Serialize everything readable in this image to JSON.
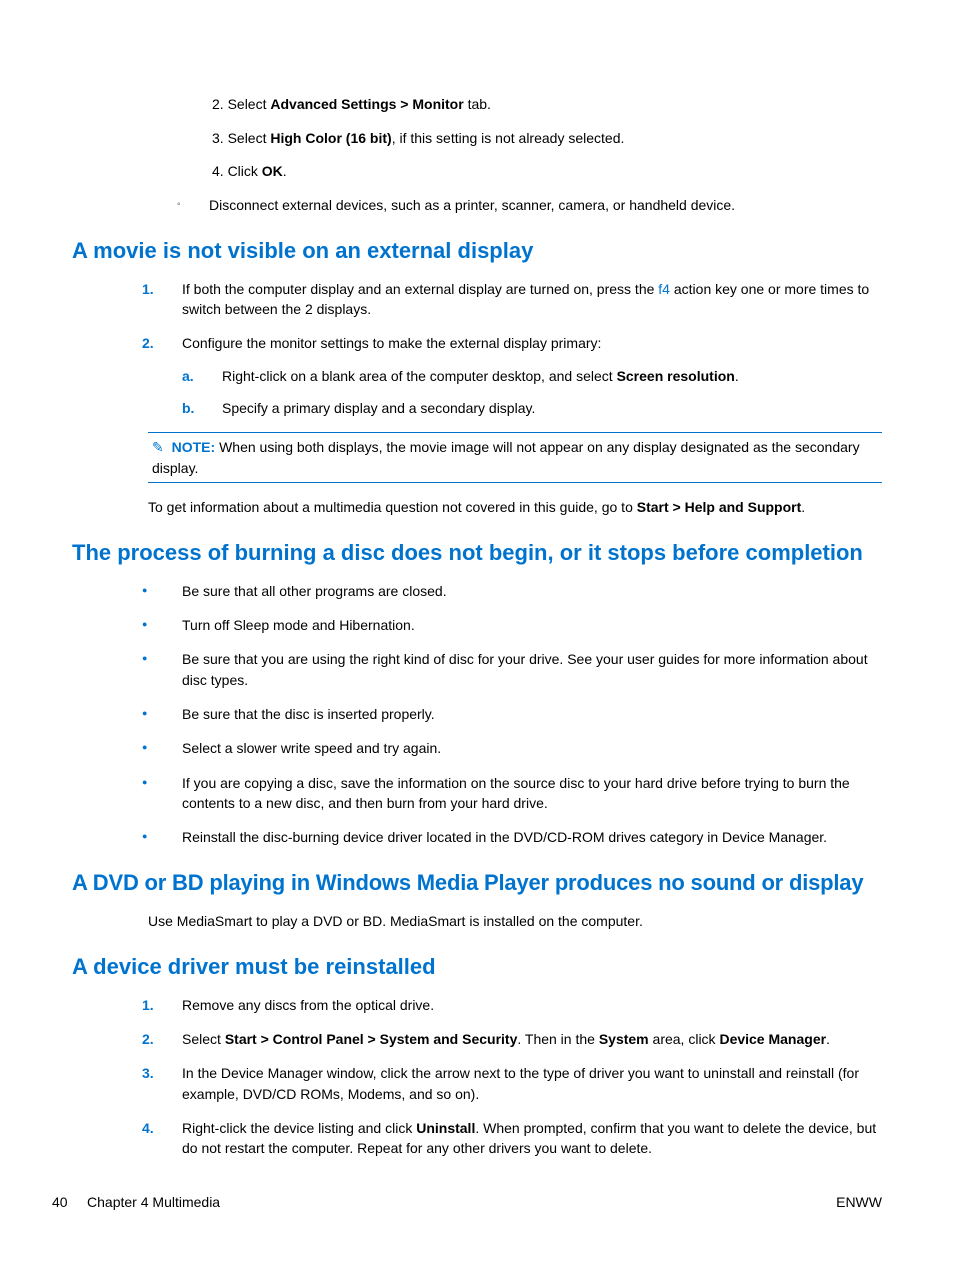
{
  "top_numbered": {
    "i2": {
      "prefix": "2. Select ",
      "bold": "Advanced Settings > Monitor",
      "suffix": " tab."
    },
    "i3": {
      "prefix": "3. Select ",
      "bold": "High Color (16 bit)",
      "suffix": ", if this setting is not already selected."
    },
    "i4": {
      "prefix": "4. Click ",
      "bold": "OK",
      "suffix": "."
    }
  },
  "disconnect": "Disconnect external devices, such as a printer, scanner, camera, or handheld device.",
  "h_movie": "A movie is not visible on an external display",
  "movie_ol": {
    "s1a": "If both the computer display and an external display are turned on, press the ",
    "s1_f4": "f4",
    "s1b": " action key one or more times to switch between the 2 displays.",
    "s2": "Configure the monitor settings to make the external display primary:",
    "sa": {
      "pre": "Right-click on a blank area of the computer desktop, and select ",
      "b": "Screen resolution",
      "post": "."
    },
    "sb": "Specify a primary display and a secondary display."
  },
  "note": {
    "label": "NOTE:",
    "text": "When using both displays, the movie image will not appear on any display designated as the secondary display."
  },
  "info_para": {
    "pre": "To get information about a multimedia question not covered in this guide, go to ",
    "b": "Start > Help and Support",
    "post": "."
  },
  "h_burn": "The process of burning a disc does not begin, or it stops before completion",
  "burn_ul": {
    "b1": "Be sure that all other programs are closed.",
    "b2": "Turn off Sleep mode and Hibernation.",
    "b3": "Be sure that you are using the right kind of disc for your drive. See your user guides for more information about disc types.",
    "b4": "Be sure that the disc is inserted properly.",
    "b5": "Select a slower write speed and try again.",
    "b6": "If you are copying a disc, save the information on the source disc to your hard drive before trying to burn the contents to a new disc, and then burn from your hard drive.",
    "b7": "Reinstall the disc-burning device driver located in the DVD/CD-ROM drives category in Device Manager."
  },
  "h_dvdbd": "A DVD or BD playing in Windows Media Player produces no sound or display",
  "dvdbd_p": "Use MediaSmart to play a DVD or BD. MediaSmart is installed on the computer.",
  "h_driver": "A device driver must be reinstalled",
  "driver_ol": {
    "d1": "Remove any discs from the optical drive.",
    "d2_pre": "Select ",
    "d2_b1": "Start > Control Panel > System and Security",
    "d2_mid": ". Then in the ",
    "d2_b2": "System",
    "d2_mid2": " area, click ",
    "d2_b3": "Device Manager",
    "d2_post": ".",
    "d3": "In the Device Manager window, click the arrow next to the type of driver you want to uninstall and reinstall (for example, DVD/CD ROMs, Modems, and so on).",
    "d4_pre": "Right-click the device listing and click ",
    "d4_b": "Uninstall",
    "d4_post": ". When prompted, confirm that you want to delete the device, but do not restart the computer. Repeat for any other drivers you want to delete."
  },
  "footer": {
    "page": "40",
    "chapter": "Chapter 4   Multimedia",
    "right": "ENWW"
  }
}
